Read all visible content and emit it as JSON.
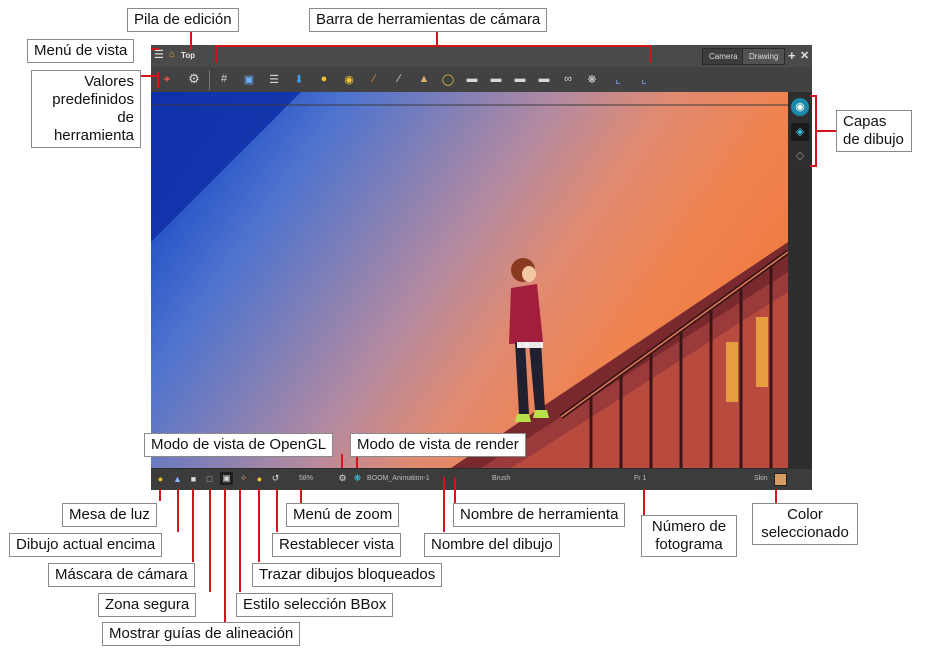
{
  "window": {
    "view_name": "Top",
    "tabs": [
      {
        "label": "Camera"
      },
      {
        "label": "Drawing"
      }
    ],
    "toolbar_icons": [
      "grid-icon",
      "field-icon",
      "bg-icon",
      "import-icon",
      "lock-icon",
      "lock-all-icon",
      "ruler-icon",
      "line-icon",
      "bell-icon",
      "onion-icon",
      "shape-1-icon",
      "shape-2-icon",
      "shape-3-icon",
      "shape-4-icon",
      "link-icon",
      "gear-icon",
      "corner-a-icon",
      "corner-b-icon"
    ]
  },
  "statusbar": {
    "zoom": "58%",
    "drawing_name": "BOOM_Animation-1",
    "tool_name": "Brush",
    "frame": "Fr 1",
    "color_name": "Skin",
    "selected_color": "#d79a62"
  },
  "callouts": {
    "pila_edicion": "Pila de edición",
    "menu_vista": "Menú de vista",
    "barra_camara": "Barra de herramientas de cámara",
    "valores_predefinidos": "Valores predefinidos de herramienta",
    "capas_dibujo": "Capas de dibujo",
    "opengl": "Modo de vista de OpenGL",
    "render": "Modo de vista de render",
    "mesa_luz": "Mesa de luz",
    "dibujo_encima": "Dibujo actual encima",
    "mascara_camara": "Máscara de cámara",
    "zona_segura": "Zona segura",
    "guias_alineacion": "Mostrar guías de alineación",
    "menu_zoom": "Menú de zoom",
    "restablecer_vista": "Restablecer vista",
    "trazar_bloqueados": "Trazar dibujos bloqueados",
    "estilo_bbox": "Estilo selección BBox",
    "nombre_herramienta": "Nombre de herramienta",
    "nombre_dibujo": "Nombre del dibujo",
    "numero_fotograma": "Número de fotograma",
    "color_seleccionado": "Color seleccionado"
  }
}
